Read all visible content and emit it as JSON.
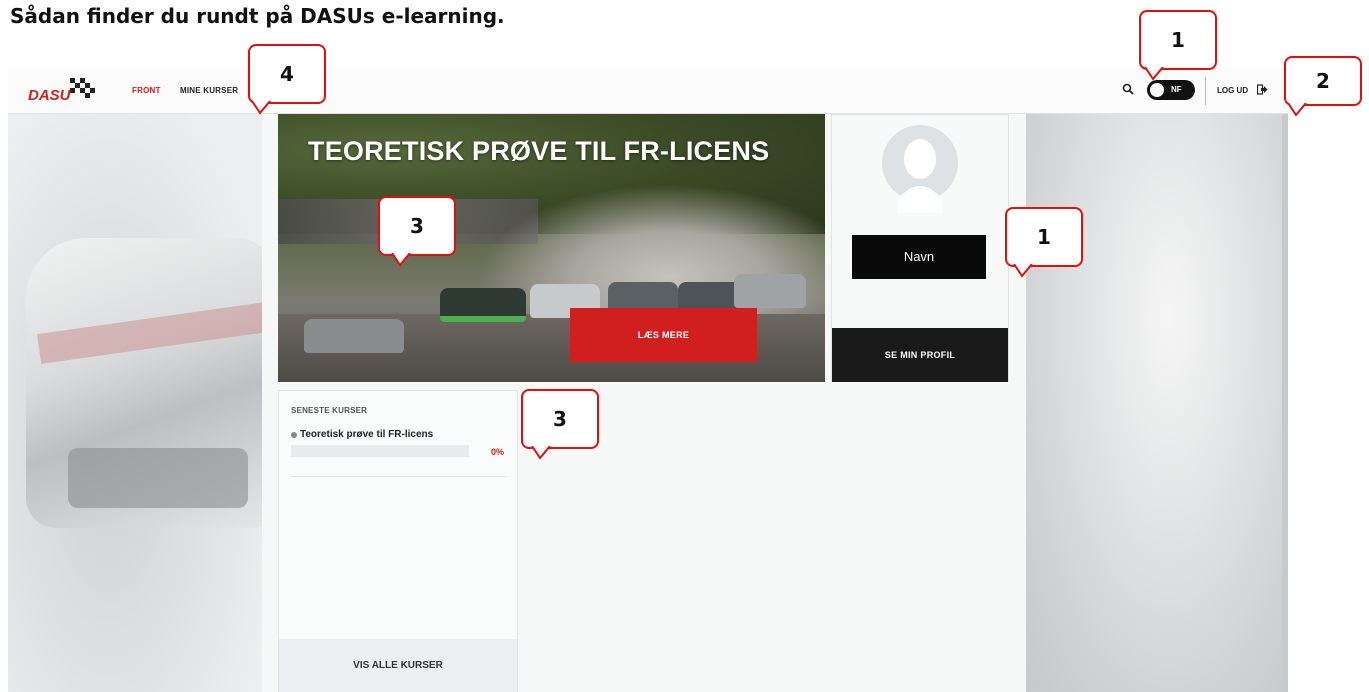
{
  "document": {
    "heading": "Sådan finder du rundt på DASUs e-learning."
  },
  "nav": {
    "logo": "DASU",
    "links": [
      "FRONT",
      "MINE KURSER"
    ],
    "toggle_label": "NF",
    "logout": "LOG UD"
  },
  "hero": {
    "title": "TEORETISK PRØVE TIL FR-LICENS",
    "button": "LÆS MERE"
  },
  "profile": {
    "name": "Navn",
    "button": "SE MIN PROFIL"
  },
  "courses": {
    "heading": "SENESTE KURSER",
    "items": [
      {
        "title": "Teoretisk prøve til FR-licens",
        "progress": 0,
        "progress_label": "0%"
      }
    ],
    "button": "VIS ALLE KURSER"
  },
  "callouts": [
    "4",
    "1",
    "2",
    "3",
    "1",
    "3"
  ],
  "colors": {
    "accent": "#d11e1e",
    "callout_border": "#e0100e",
    "dark": "#111111"
  }
}
